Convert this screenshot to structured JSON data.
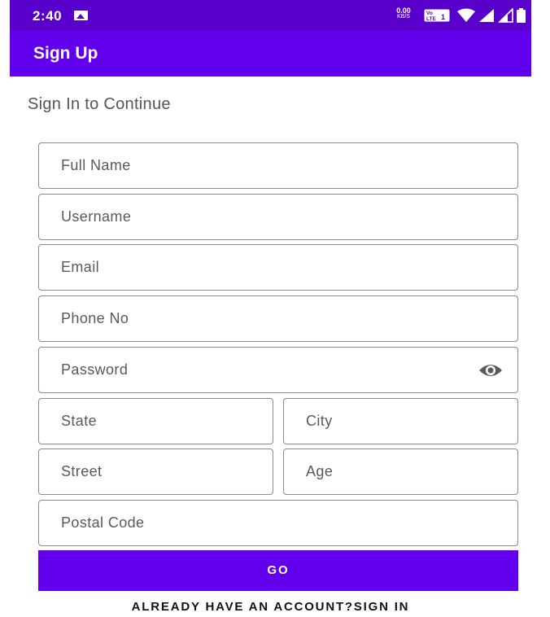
{
  "status_bar": {
    "time": "2:40",
    "speed_value": "0.00",
    "speed_unit": "KB/S",
    "volte": "Vo LTE 1",
    "icons": [
      "image-notification-icon",
      "volte-icon",
      "wifi-icon",
      "cell-signal-icon",
      "cell-signal-icon",
      "battery-icon"
    ],
    "color": "#5a00cc"
  },
  "app_bar": {
    "title": "Sign Up",
    "color": "#6200ee"
  },
  "subtitle": "Sign In to Continue",
  "form": {
    "full_name": {
      "placeholder": "Full Name",
      "value": ""
    },
    "username": {
      "placeholder": "Username",
      "value": ""
    },
    "email": {
      "placeholder": "Email",
      "value": ""
    },
    "phone": {
      "placeholder": "Phone No",
      "value": ""
    },
    "password": {
      "placeholder": "Password",
      "value": "",
      "toggle_icon": "eye-icon"
    },
    "state": {
      "placeholder": "State",
      "value": ""
    },
    "city": {
      "placeholder": "City",
      "value": ""
    },
    "street": {
      "placeholder": "Street",
      "value": ""
    },
    "age": {
      "placeholder": "Age",
      "value": ""
    },
    "postal_code": {
      "placeholder": "Postal Code",
      "value": ""
    }
  },
  "go_button": {
    "label": "GO",
    "color": "#6200ee"
  },
  "signin_link": "ALREADY HAVE AN ACCOUNT?SIGN IN"
}
